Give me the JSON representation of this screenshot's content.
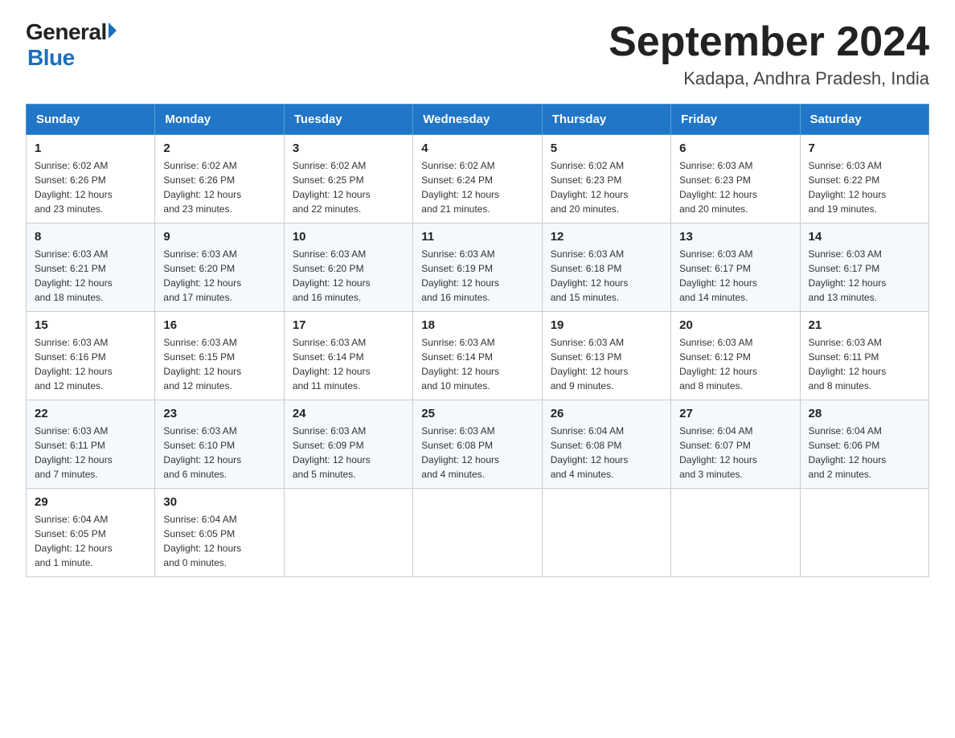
{
  "logo": {
    "general": "General",
    "blue": "Blue"
  },
  "title": "September 2024",
  "subtitle": "Kadapa, Andhra Pradesh, India",
  "days": [
    "Sunday",
    "Monday",
    "Tuesday",
    "Wednesday",
    "Thursday",
    "Friday",
    "Saturday"
  ],
  "weeks": [
    [
      {
        "date": "1",
        "sunrise": "6:02 AM",
        "sunset": "6:26 PM",
        "daylight": "12 hours and 23 minutes."
      },
      {
        "date": "2",
        "sunrise": "6:02 AM",
        "sunset": "6:26 PM",
        "daylight": "12 hours and 23 minutes."
      },
      {
        "date": "3",
        "sunrise": "6:02 AM",
        "sunset": "6:25 PM",
        "daylight": "12 hours and 22 minutes."
      },
      {
        "date": "4",
        "sunrise": "6:02 AM",
        "sunset": "6:24 PM",
        "daylight": "12 hours and 21 minutes."
      },
      {
        "date": "5",
        "sunrise": "6:02 AM",
        "sunset": "6:23 PM",
        "daylight": "12 hours and 20 minutes."
      },
      {
        "date": "6",
        "sunrise": "6:03 AM",
        "sunset": "6:23 PM",
        "daylight": "12 hours and 20 minutes."
      },
      {
        "date": "7",
        "sunrise": "6:03 AM",
        "sunset": "6:22 PM",
        "daylight": "12 hours and 19 minutes."
      }
    ],
    [
      {
        "date": "8",
        "sunrise": "6:03 AM",
        "sunset": "6:21 PM",
        "daylight": "12 hours and 18 minutes."
      },
      {
        "date": "9",
        "sunrise": "6:03 AM",
        "sunset": "6:20 PM",
        "daylight": "12 hours and 17 minutes."
      },
      {
        "date": "10",
        "sunrise": "6:03 AM",
        "sunset": "6:20 PM",
        "daylight": "12 hours and 16 minutes."
      },
      {
        "date": "11",
        "sunrise": "6:03 AM",
        "sunset": "6:19 PM",
        "daylight": "12 hours and 16 minutes."
      },
      {
        "date": "12",
        "sunrise": "6:03 AM",
        "sunset": "6:18 PM",
        "daylight": "12 hours and 15 minutes."
      },
      {
        "date": "13",
        "sunrise": "6:03 AM",
        "sunset": "6:17 PM",
        "daylight": "12 hours and 14 minutes."
      },
      {
        "date": "14",
        "sunrise": "6:03 AM",
        "sunset": "6:17 PM",
        "daylight": "12 hours and 13 minutes."
      }
    ],
    [
      {
        "date": "15",
        "sunrise": "6:03 AM",
        "sunset": "6:16 PM",
        "daylight": "12 hours and 12 minutes."
      },
      {
        "date": "16",
        "sunrise": "6:03 AM",
        "sunset": "6:15 PM",
        "daylight": "12 hours and 12 minutes."
      },
      {
        "date": "17",
        "sunrise": "6:03 AM",
        "sunset": "6:14 PM",
        "daylight": "12 hours and 11 minutes."
      },
      {
        "date": "18",
        "sunrise": "6:03 AM",
        "sunset": "6:14 PM",
        "daylight": "12 hours and 10 minutes."
      },
      {
        "date": "19",
        "sunrise": "6:03 AM",
        "sunset": "6:13 PM",
        "daylight": "12 hours and 9 minutes."
      },
      {
        "date": "20",
        "sunrise": "6:03 AM",
        "sunset": "6:12 PM",
        "daylight": "12 hours and 8 minutes."
      },
      {
        "date": "21",
        "sunrise": "6:03 AM",
        "sunset": "6:11 PM",
        "daylight": "12 hours and 8 minutes."
      }
    ],
    [
      {
        "date": "22",
        "sunrise": "6:03 AM",
        "sunset": "6:11 PM",
        "daylight": "12 hours and 7 minutes."
      },
      {
        "date": "23",
        "sunrise": "6:03 AM",
        "sunset": "6:10 PM",
        "daylight": "12 hours and 6 minutes."
      },
      {
        "date": "24",
        "sunrise": "6:03 AM",
        "sunset": "6:09 PM",
        "daylight": "12 hours and 5 minutes."
      },
      {
        "date": "25",
        "sunrise": "6:03 AM",
        "sunset": "6:08 PM",
        "daylight": "12 hours and 4 minutes."
      },
      {
        "date": "26",
        "sunrise": "6:04 AM",
        "sunset": "6:08 PM",
        "daylight": "12 hours and 4 minutes."
      },
      {
        "date": "27",
        "sunrise": "6:04 AM",
        "sunset": "6:07 PM",
        "daylight": "12 hours and 3 minutes."
      },
      {
        "date": "28",
        "sunrise": "6:04 AM",
        "sunset": "6:06 PM",
        "daylight": "12 hours and 2 minutes."
      }
    ],
    [
      {
        "date": "29",
        "sunrise": "6:04 AM",
        "sunset": "6:05 PM",
        "daylight": "12 hours and 1 minute."
      },
      {
        "date": "30",
        "sunrise": "6:04 AM",
        "sunset": "6:05 PM",
        "daylight": "12 hours and 0 minutes."
      },
      null,
      null,
      null,
      null,
      null
    ]
  ],
  "labels": {
    "sunrise": "Sunrise:",
    "sunset": "Sunset:",
    "daylight": "Daylight:"
  }
}
